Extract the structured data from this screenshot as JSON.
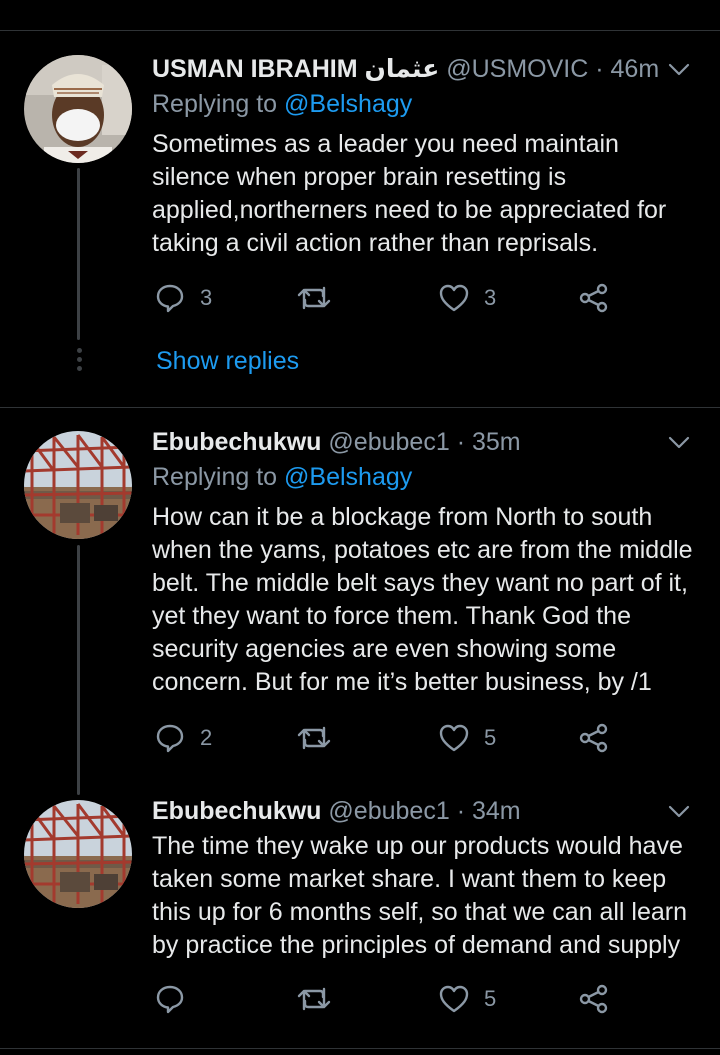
{
  "tweets": [
    {
      "name": "USMAN IBRAHIM عثمان",
      "handle": "@USMOVIC",
      "time": "· 46m",
      "replying_prefix": "Replying to",
      "replying_to": "@Belshagy",
      "text": "Sometimes as a leader you need maintain silence when proper brain resetting is applied,northerners need to be appreciated for taking a civil action rather than reprisals.",
      "reply_count": "3",
      "retweet_count": "",
      "like_count": "3"
    },
    {
      "name": "Ebubechukwu",
      "handle": "@ebubec1",
      "time": "· 35m",
      "replying_prefix": "Replying to",
      "replying_to": "@Belshagy",
      "text": "How can it be a blockage from North to south when the yams, potatoes etc are from the middle belt. The middle belt says they want no part of it, yet they want to force them. Thank God the security agencies are even showing some concern. But for me it’s better business, by /1",
      "reply_count": "2",
      "retweet_count": "",
      "like_count": "5"
    },
    {
      "name": "Ebubechukwu",
      "handle": "@ebubec1",
      "time": "· 34m",
      "text": "The time they wake up our products would have taken some market share. I want them to keep this up for 6 months self, so that we can all learn by practice the principles of demand and supply",
      "reply_count": "",
      "retweet_count": "",
      "like_count": "5"
    }
  ],
  "show_replies_label": "Show replies",
  "colors": {
    "accent": "#1d9bf0",
    "muted": "#8b98a5",
    "text": "#e7e9ea",
    "background": "#000000"
  },
  "icons": [
    "chevron-down-icon",
    "reply-icon",
    "retweet-icon",
    "like-icon",
    "share-icon"
  ]
}
